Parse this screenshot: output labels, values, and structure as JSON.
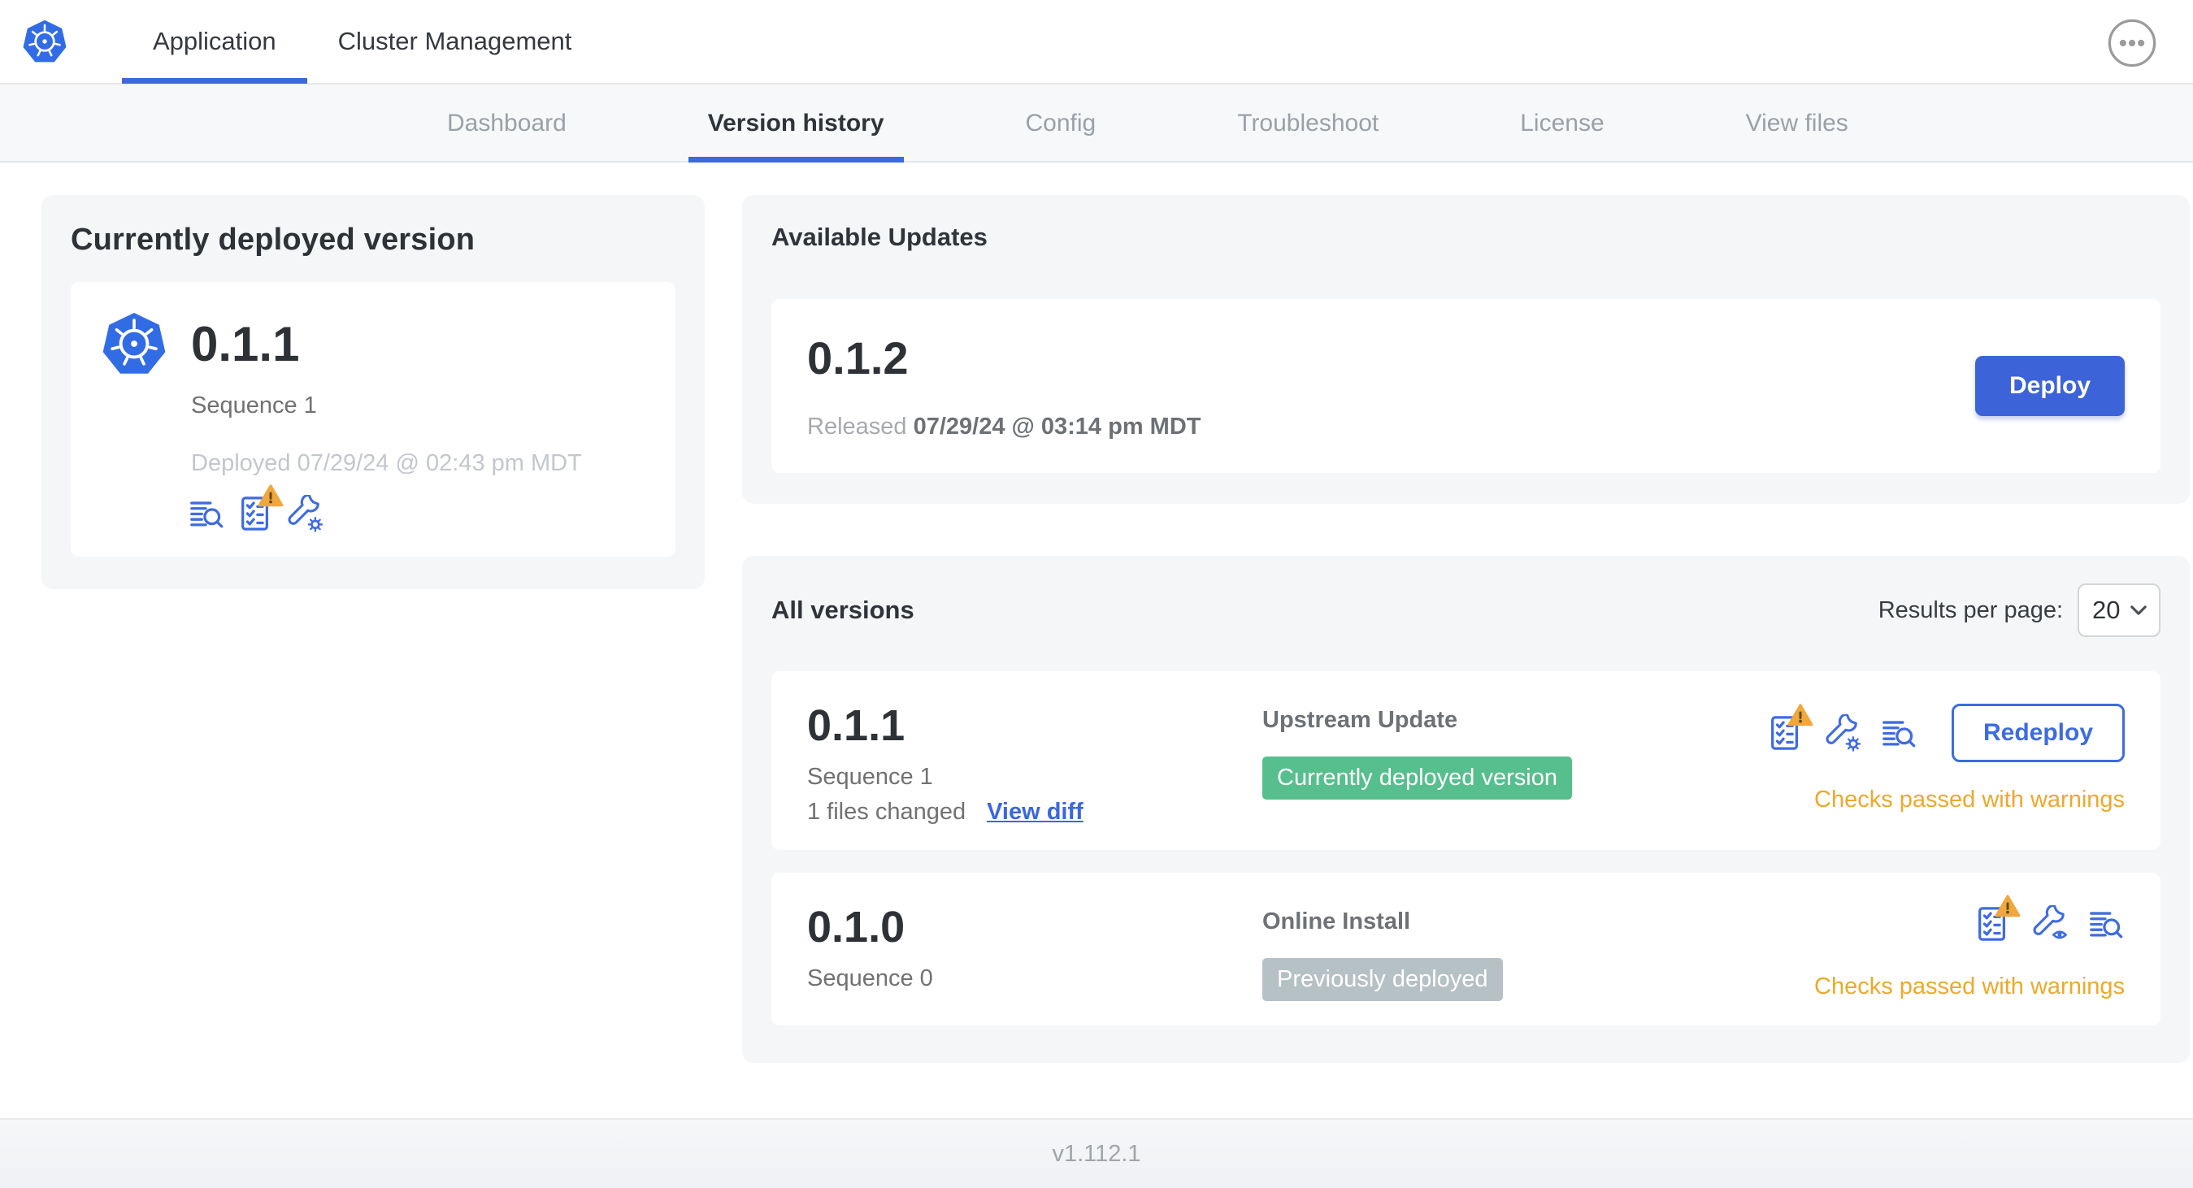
{
  "header": {
    "tabs": [
      {
        "label": "Application",
        "active": true
      },
      {
        "label": "Cluster Management",
        "active": false
      }
    ],
    "overflow_icon": "ellipsis-icon",
    "logo_icon": "kubernetes-logo"
  },
  "subnav": {
    "tabs": [
      "Dashboard",
      "Version history",
      "Config",
      "Troubleshoot",
      "License",
      "View files"
    ],
    "active_tab": "Version history"
  },
  "current_version": {
    "title": "Currently deployed version",
    "version": "0.1.1",
    "sequence": "Sequence 1",
    "deployed": "Deployed 07/29/24 @ 02:43 pm MDT",
    "icons": [
      "diff-search-icon",
      "checklist-warning-icon",
      "wrench-gear-icon"
    ]
  },
  "available_updates": {
    "title": "Available Updates",
    "version": "0.1.2",
    "released_prefix": "Released",
    "released_date": "07/29/24 @ 03:14 pm MDT",
    "deploy_label": "Deploy"
  },
  "all_versions": {
    "title": "All versions",
    "results_per_page_label": "Results per page:",
    "results_per_page_value": "20",
    "rows": [
      {
        "version": "0.1.1",
        "sequence": "Sequence 1",
        "files_changed": "1 files changed",
        "view_diff_label": "View diff",
        "source": "Upstream Update",
        "badge": "Currently deployed version",
        "badge_type": "success",
        "icons": [
          "checklist-warning-icon",
          "wrench-gear-icon",
          "diff-search-icon"
        ],
        "action_label": "Redeploy",
        "status": "Checks passed with warnings"
      },
      {
        "version": "0.1.0",
        "sequence": "Sequence 0",
        "source": "Online Install",
        "badge": "Previously deployed",
        "badge_type": "muted",
        "icons": [
          "checklist-warning-icon",
          "wrench-eye-icon",
          "diff-search-icon"
        ],
        "status": "Checks passed with warnings"
      }
    ]
  },
  "footer": {
    "version": "v1.112.1"
  },
  "colors": {
    "accent": "#3E68DC",
    "icon_blue": "#3F6BE2",
    "logo_blue": "#326CE5",
    "success_badge": "#56BF8D",
    "muted_badge": "#B6C1C6",
    "warning_text": "#ECA92B",
    "warning_triangle": "#F0A73C"
  }
}
